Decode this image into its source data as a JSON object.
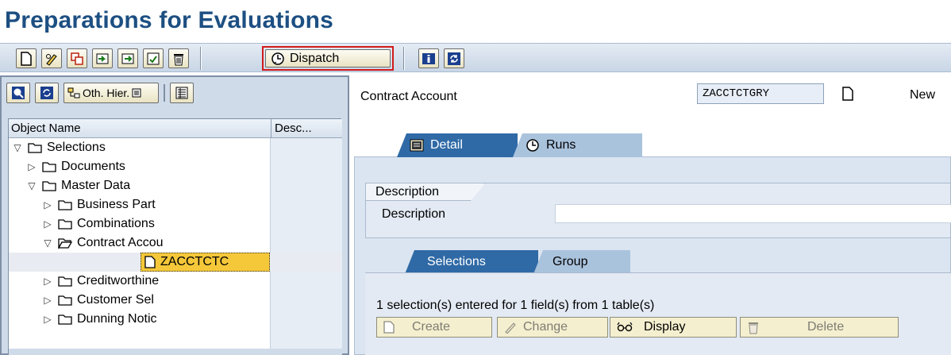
{
  "page": {
    "title": "Preparations for Evaluations"
  },
  "toolbar": {
    "dispatch_label": "Dispatch"
  },
  "left_toolbar": {
    "other_hierarchy_label": "Oth. Hier."
  },
  "tree": {
    "columns": [
      "Object Name",
      "Desc..."
    ],
    "nodes": [
      {
        "label": "Selections",
        "expanded": true
      },
      {
        "label": "Documents",
        "expanded": false
      },
      {
        "label": "Master Data",
        "expanded": true
      },
      {
        "label": "Business Part",
        "expanded": false
      },
      {
        "label": "Combinations",
        "expanded": false
      },
      {
        "label": "Contract Accou",
        "expanded": true
      },
      {
        "label": "ZACCTCTC",
        "selected": true
      },
      {
        "label": "Creditworthine",
        "expanded": false
      },
      {
        "label": "Customer Sel",
        "expanded": false
      },
      {
        "label": "Dunning Notic",
        "expanded": false
      }
    ]
  },
  "header": {
    "contract_account_label": "Contract Account",
    "contract_account_value": "ZACCTCTGRY",
    "new_label": "New"
  },
  "tabs": [
    {
      "label": "Detail",
      "active": true
    },
    {
      "label": "Runs",
      "active": false
    }
  ],
  "description_group": {
    "title": "Description",
    "field_label": "Description",
    "field_value": ""
  },
  "selection_tabs": [
    {
      "label": "Selections",
      "active": true
    },
    {
      "label": "Group",
      "active": false
    }
  ],
  "selections": {
    "summary": "1 selection(s) entered for 1 field(s) from 1 table(s)",
    "buttons": {
      "create": "Create",
      "change": "Change",
      "display": "Display",
      "delete": "Delete"
    }
  },
  "colors": {
    "title": "#1d4f82",
    "tab_active": "#2f6aa6",
    "tab_inactive": "#aac3dd",
    "selected_node": "#f5c83a",
    "dispatch_highlight": "#d11b1b"
  }
}
